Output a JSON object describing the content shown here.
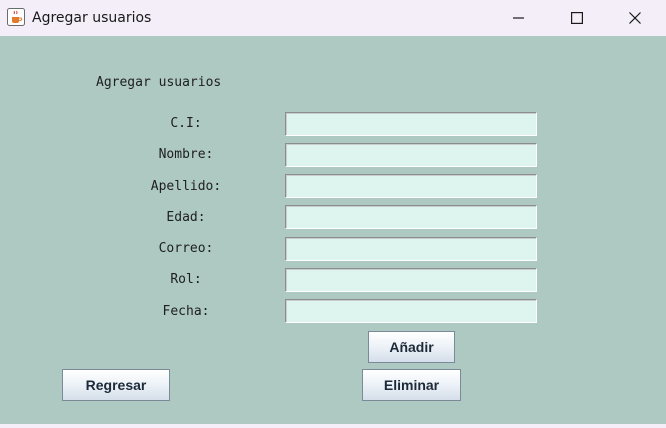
{
  "window": {
    "title": "Agregar usuarios",
    "icon": "java-cup-icon",
    "controls": {
      "minimize": "minimize-icon",
      "maximize": "maximize-icon",
      "close": "close-icon"
    }
  },
  "form": {
    "heading": "Agregar usuarios",
    "fields": [
      {
        "label": "C.I:",
        "value": ""
      },
      {
        "label": "Nombre:",
        "value": ""
      },
      {
        "label": "Apellido:",
        "value": ""
      },
      {
        "label": "Edad:",
        "value": ""
      },
      {
        "label": "Correo:",
        "value": ""
      },
      {
        "label": "Rol:",
        "value": ""
      },
      {
        "label": "Fecha:",
        "value": ""
      }
    ]
  },
  "buttons": {
    "add": "Añadir",
    "back": "Regresar",
    "delete": "Eliminar"
  },
  "colors": {
    "background": "#adc9c1",
    "input_background": "#def5ef",
    "titlebar": "#f3eef7"
  }
}
